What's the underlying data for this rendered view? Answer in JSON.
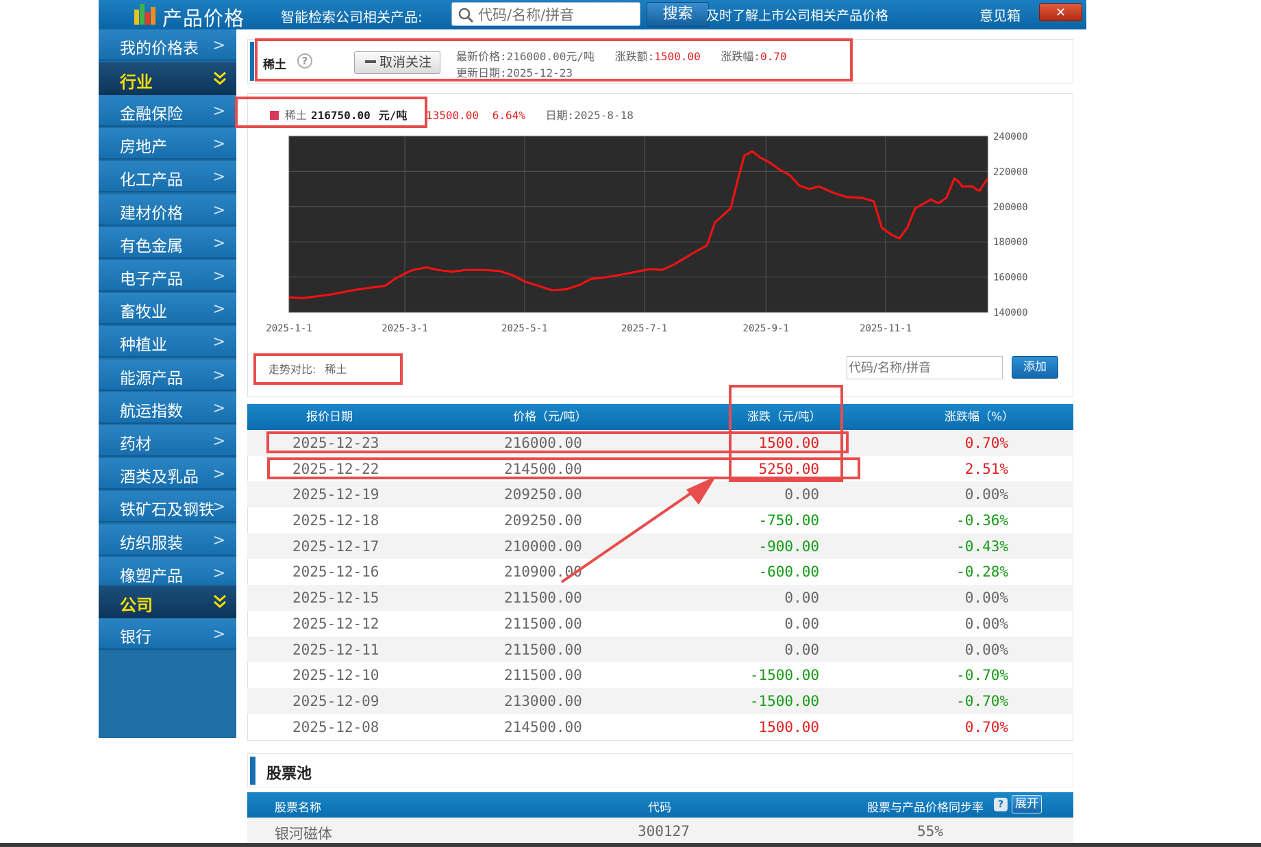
{
  "header": {
    "app_title": "产品价格",
    "search_label": "智能检索公司相关产品:",
    "search_placeholder": "代码/名称/拼音",
    "search_button": "搜索",
    "tip": "及时了解上市公司相关产品价格",
    "feedback": "意见箱",
    "close_label": "✕"
  },
  "sidebar": {
    "top_item": "我的价格表",
    "industry_section": "行业",
    "industry_items": [
      "金融保险",
      "房地产",
      "化工产品",
      "建材价格",
      "有色金属",
      "电子产品",
      "畜牧业",
      "种植业",
      "能源产品",
      "航运指数",
      "药材",
      "酒类及乳品",
      "铁矿石及钢铁",
      "纺织服装",
      "橡塑产品"
    ],
    "company_section": "公司",
    "company_items": [
      "银行"
    ]
  },
  "product_info": {
    "name": "稀土",
    "unfollow_button": "取消关注",
    "latest_price_label": "最新价格:",
    "latest_price": "216000.00元/吨",
    "change_label": "涨跌额:",
    "change": "1500.00",
    "pct_label": "涨跌幅:",
    "pct": "0.70",
    "update_label": "更新日期:",
    "update_date": "2025-12-23"
  },
  "chart_legend": {
    "series": "稀土",
    "value": "216750.00",
    "unit": "元/吨",
    "change": "13500.00",
    "pct": "6.64%",
    "date_label": "日期:",
    "date": "2025-8-18"
  },
  "chart_data": {
    "type": "line",
    "x_tick_labels": [
      "2025-1-1",
      "2025-3-1",
      "2025-5-1",
      "2025-7-1",
      "2025-9-1",
      "2025-11-1"
    ],
    "y_tick_labels": [
      "240000",
      "220000",
      "200000",
      "180000",
      "160000",
      "140000"
    ],
    "ylim": [
      140000,
      240000
    ],
    "xlim": [
      "2025-01-01",
      "2025-12-23"
    ],
    "grid": true,
    "background": "#2b2b2b",
    "line_color": "#ff1010",
    "series": [
      {
        "name": "稀土",
        "points": [
          [
            "2025-01-01",
            148500
          ],
          [
            "2025-01-08",
            148000
          ],
          [
            "2025-01-15",
            149000
          ],
          [
            "2025-01-22",
            150000
          ],
          [
            "2025-01-29",
            151500
          ],
          [
            "2025-02-05",
            153000
          ],
          [
            "2025-02-12",
            154000
          ],
          [
            "2025-02-19",
            155000
          ],
          [
            "2025-02-24",
            159000
          ],
          [
            "2025-03-01",
            162000
          ],
          [
            "2025-03-05",
            164000
          ],
          [
            "2025-03-12",
            165500
          ],
          [
            "2025-03-18",
            164000
          ],
          [
            "2025-03-25",
            163000
          ],
          [
            "2025-04-01",
            164000
          ],
          [
            "2025-04-10",
            164000
          ],
          [
            "2025-04-18",
            163500
          ],
          [
            "2025-04-25",
            161000
          ],
          [
            "2025-05-01",
            157500
          ],
          [
            "2025-05-08",
            155000
          ],
          [
            "2025-05-15",
            152500
          ],
          [
            "2025-05-22",
            153000
          ],
          [
            "2025-05-29",
            155500
          ],
          [
            "2025-06-04",
            159000
          ],
          [
            "2025-06-12",
            160000
          ],
          [
            "2025-06-20",
            161500
          ],
          [
            "2025-06-27",
            163000
          ],
          [
            "2025-07-04",
            164500
          ],
          [
            "2025-07-10",
            164000
          ],
          [
            "2025-07-16",
            167000
          ],
          [
            "2025-07-22",
            171000
          ],
          [
            "2025-07-28",
            175000
          ],
          [
            "2025-08-02",
            178000
          ],
          [
            "2025-08-06",
            191000
          ],
          [
            "2025-08-10",
            195000
          ],
          [
            "2025-08-14",
            199000
          ],
          [
            "2025-08-18",
            216750
          ],
          [
            "2025-08-21",
            229000
          ],
          [
            "2025-08-25",
            231500
          ],
          [
            "2025-08-29",
            228000
          ],
          [
            "2025-09-03",
            225000
          ],
          [
            "2025-09-08",
            221000
          ],
          [
            "2025-09-13",
            218000
          ],
          [
            "2025-09-18",
            212000
          ],
          [
            "2025-09-23",
            210000
          ],
          [
            "2025-09-28",
            211500
          ],
          [
            "2025-10-05",
            208000
          ],
          [
            "2025-10-12",
            205500
          ],
          [
            "2025-10-20",
            205000
          ],
          [
            "2025-10-26",
            203000
          ],
          [
            "2025-10-30",
            188000
          ],
          [
            "2025-11-04",
            184000
          ],
          [
            "2025-11-08",
            182000
          ],
          [
            "2025-11-12",
            188000
          ],
          [
            "2025-11-16",
            199000
          ],
          [
            "2025-11-20",
            201500
          ],
          [
            "2025-11-24",
            204000
          ],
          [
            "2025-11-28",
            202000
          ],
          [
            "2025-12-02",
            205000
          ],
          [
            "2025-12-06",
            216000
          ],
          [
            "2025-12-08",
            214500
          ],
          [
            "2025-12-09",
            213000
          ],
          [
            "2025-12-10",
            211500
          ],
          [
            "2025-12-15",
            211500
          ],
          [
            "2025-12-16",
            210900
          ],
          [
            "2025-12-17",
            210000
          ],
          [
            "2025-12-18",
            209250
          ],
          [
            "2025-12-19",
            209250
          ],
          [
            "2025-12-22",
            214500
          ],
          [
            "2025-12-23",
            216000
          ]
        ]
      }
    ]
  },
  "compare": {
    "label": "走势对比:",
    "value": "稀土",
    "input_placeholder": "代码/名称/拼音",
    "add_button": "添加"
  },
  "price_table": {
    "headers": [
      "报价日期",
      "价格（元/吨）",
      "涨跌（元/吨）",
      "涨跌幅（%）"
    ],
    "rows": [
      {
        "date": "2025-12-23",
        "price": "216000.00",
        "change": "1500.00",
        "pct": "0.70%",
        "dir": "up"
      },
      {
        "date": "2025-12-22",
        "price": "214500.00",
        "change": "5250.00",
        "pct": "2.51%",
        "dir": "up"
      },
      {
        "date": "2025-12-19",
        "price": "209250.00",
        "change": "0.00",
        "pct": "0.00%",
        "dir": "flat"
      },
      {
        "date": "2025-12-18",
        "price": "209250.00",
        "change": "-750.00",
        "pct": "-0.36%",
        "dir": "down"
      },
      {
        "date": "2025-12-17",
        "price": "210000.00",
        "change": "-900.00",
        "pct": "-0.43%",
        "dir": "down"
      },
      {
        "date": "2025-12-16",
        "price": "210900.00",
        "change": "-600.00",
        "pct": "-0.28%",
        "dir": "down"
      },
      {
        "date": "2025-12-15",
        "price": "211500.00",
        "change": "0.00",
        "pct": "0.00%",
        "dir": "flat"
      },
      {
        "date": "2025-12-12",
        "price": "211500.00",
        "change": "0.00",
        "pct": "0.00%",
        "dir": "flat"
      },
      {
        "date": "2025-12-11",
        "price": "211500.00",
        "change": "0.00",
        "pct": "0.00%",
        "dir": "flat"
      },
      {
        "date": "2025-12-10",
        "price": "211500.00",
        "change": "-1500.00",
        "pct": "-0.70%",
        "dir": "down"
      },
      {
        "date": "2025-12-09",
        "price": "213000.00",
        "change": "-1500.00",
        "pct": "-0.70%",
        "dir": "down"
      },
      {
        "date": "2025-12-08",
        "price": "214500.00",
        "change": "1500.00",
        "pct": "0.70%",
        "dir": "up"
      }
    ]
  },
  "stock_pool": {
    "title": "股票池",
    "headers": [
      "股票名称",
      "代码",
      "股票与产品价格同步率"
    ],
    "help_icon": "?",
    "expand_button": "展开",
    "rows": [
      {
        "name": "银河磁体",
        "code": "300127",
        "sync": "55%"
      }
    ]
  },
  "colors": {
    "up": "#e02020",
    "down": "#169b16",
    "flat": "#666666",
    "annotation": "#e84c4c"
  }
}
